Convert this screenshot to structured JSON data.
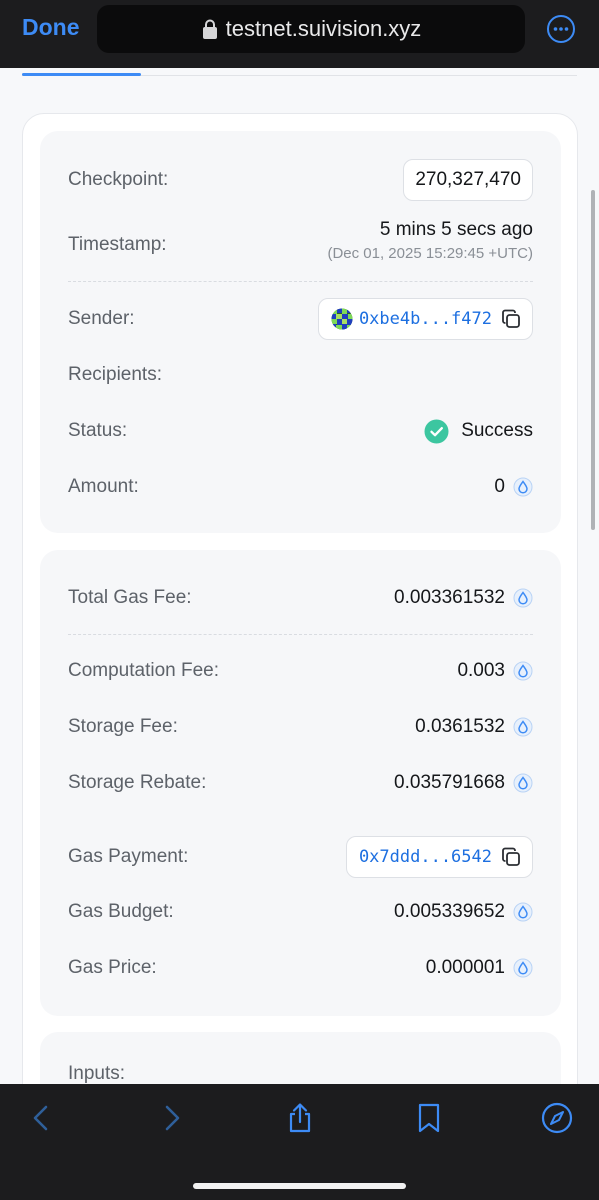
{
  "browser": {
    "done_label": "Done",
    "url": "testnet.suivision.xyz"
  },
  "tx": {
    "checkpoint_label": "Checkpoint:",
    "checkpoint_value": "270,327,470",
    "timestamp_label": "Timestamp:",
    "timestamp_relative": "5 mins 5 secs ago",
    "timestamp_absolute": "(Dec 01, 2025 15:29:45 +UTC)",
    "sender_label": "Sender:",
    "sender_address": "0xbe4b...f472",
    "recipients_label": "Recipients:",
    "status_label": "Status:",
    "status_value": "Success",
    "amount_label": "Amount:",
    "amount_value": "0"
  },
  "gas": {
    "total_label": "Total Gas Fee:",
    "total_value": "0.003361532",
    "computation_label": "Computation Fee:",
    "computation_value": "0.003",
    "storage_label": "Storage Fee:",
    "storage_value": "0.0361532",
    "rebate_label": "Storage Rebate:",
    "rebate_value": "0.035791668",
    "payment_label": "Gas Payment:",
    "payment_address": "0x7ddd...6542",
    "budget_label": "Gas Budget:",
    "budget_value": "0.005339652",
    "price_label": "Gas Price:",
    "price_value": "0.000001"
  },
  "inputs": {
    "label": "Inputs:"
  },
  "colors": {
    "accent": "#3d8bf5",
    "success": "#3cc6a0",
    "address": "#1d6fe0"
  },
  "icons": [
    "lock-icon",
    "more-icon",
    "copy-icon",
    "sui-drop-icon",
    "check-circle-icon",
    "back-icon",
    "forward-icon",
    "share-icon",
    "bookmarks-icon",
    "compass-icon"
  ]
}
